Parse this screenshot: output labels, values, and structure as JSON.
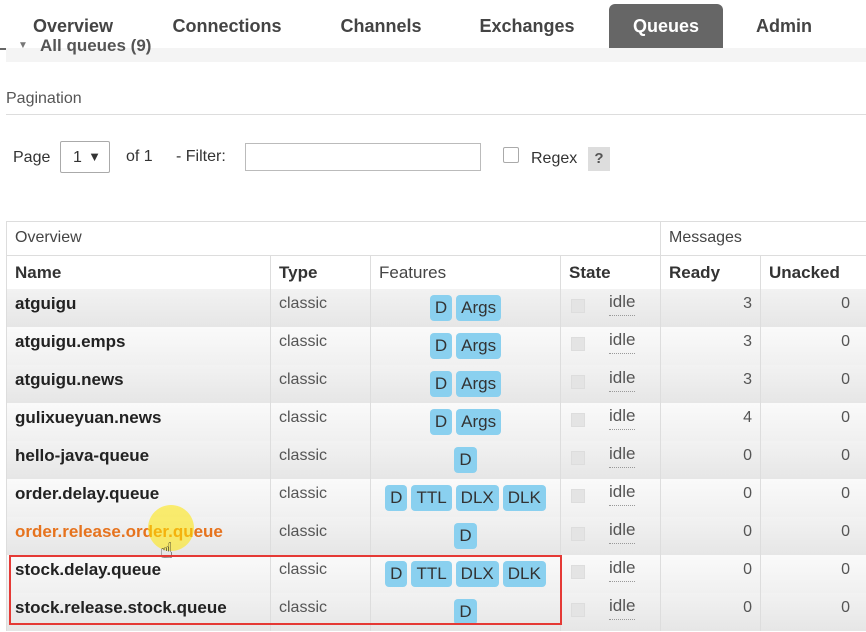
{
  "nav": {
    "tabs": [
      {
        "label": "Overview"
      },
      {
        "label": "Connections"
      },
      {
        "label": "Channels"
      },
      {
        "label": "Exchanges"
      },
      {
        "label": "Queues"
      },
      {
        "label": "Admin"
      }
    ],
    "active": "Queues"
  },
  "section_heading": "All queues (9)",
  "pagination": {
    "title": "Pagination",
    "page_label": "Page",
    "page_value": "1",
    "of_label": "of 1",
    "filter_label": "- Filter:",
    "filter_value": "",
    "regex_label": "Regex",
    "help_label": "?"
  },
  "table": {
    "groups": {
      "overview": "Overview",
      "messages": "Messages"
    },
    "columns": {
      "name": "Name",
      "type": "Type",
      "features": "Features",
      "state": "State",
      "ready": "Ready",
      "unacked": "Unacked"
    },
    "rows": [
      {
        "name": "atguigu",
        "type": "classic",
        "features": [
          "D",
          "Args"
        ],
        "state": "idle",
        "ready": "3",
        "unacked": "0"
      },
      {
        "name": "atguigu.emps",
        "type": "classic",
        "features": [
          "D",
          "Args"
        ],
        "state": "idle",
        "ready": "3",
        "unacked": "0"
      },
      {
        "name": "atguigu.news",
        "type": "classic",
        "features": [
          "D",
          "Args"
        ],
        "state": "idle",
        "ready": "3",
        "unacked": "0"
      },
      {
        "name": "gulixueyuan.news",
        "type": "classic",
        "features": [
          "D",
          "Args"
        ],
        "state": "idle",
        "ready": "4",
        "unacked": "0"
      },
      {
        "name": "hello-java-queue",
        "type": "classic",
        "features": [
          "D"
        ],
        "state": "idle",
        "ready": "0",
        "unacked": "0"
      },
      {
        "name": "order.delay.queue",
        "type": "classic",
        "features": [
          "D",
          "TTL",
          "DLX",
          "DLK"
        ],
        "state": "idle",
        "ready": "0",
        "unacked": "0"
      },
      {
        "name": "order.release.order.queue",
        "type": "classic",
        "features": [
          "D"
        ],
        "state": "idle",
        "ready": "0",
        "unacked": "0"
      },
      {
        "name": "stock.delay.queue",
        "type": "classic",
        "features": [
          "D",
          "TTL",
          "DLX",
          "DLK"
        ],
        "state": "idle",
        "ready": "0",
        "unacked": "0"
      },
      {
        "name": "stock.release.stock.queue",
        "type": "classic",
        "features": [
          "D"
        ],
        "state": "idle",
        "ready": "0",
        "unacked": "0"
      }
    ]
  },
  "colors": {
    "accent_tab": "#666666",
    "feature_badge": "#8ad0ef",
    "hover_link": "#e6731e",
    "highlight_box": "#e53935"
  }
}
